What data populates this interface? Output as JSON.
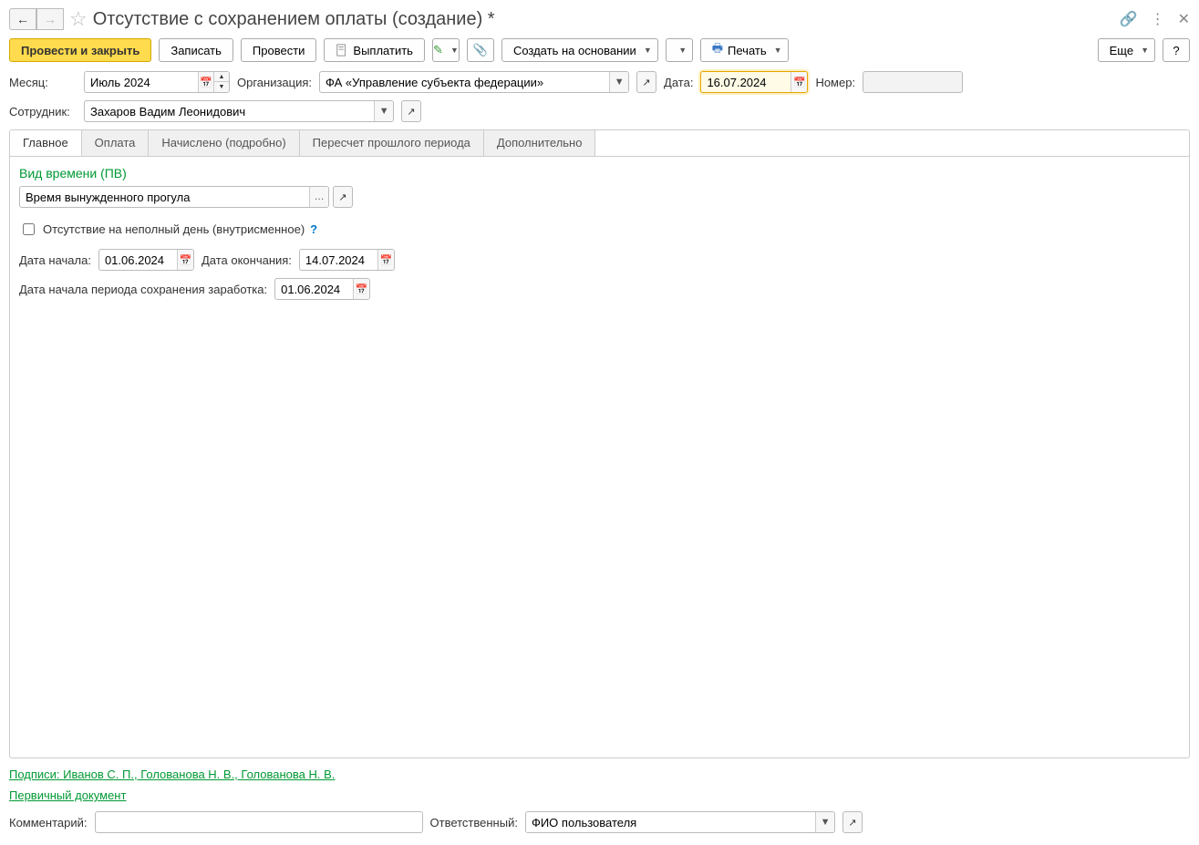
{
  "title": "Отсутствие с сохранением оплаты (создание) *",
  "toolbar": {
    "post_close": "Провести и закрыть",
    "save": "Записать",
    "post": "Провести",
    "pay": "Выплатить",
    "create_based": "Создать на основании",
    "print": "Печать",
    "more": "Еще",
    "help": "?"
  },
  "header": {
    "month_label": "Месяц:",
    "month_value": "Июль 2024",
    "org_label": "Организация:",
    "org_value": "ФА «Управление субъекта федерации»",
    "date_label": "Дата:",
    "date_value": "16.07.2024",
    "number_label": "Номер:",
    "number_value": "",
    "employee_label": "Сотрудник:",
    "employee_value": "Захаров Вадим Леонидович"
  },
  "tabs": {
    "main": "Главное",
    "payment": "Оплата",
    "accrued": "Начислено (подробно)",
    "recalc": "Пересчет прошлого периода",
    "extra": "Дополнительно"
  },
  "main_tab": {
    "time_type_title": "Вид времени (ПВ)",
    "time_type_value": "Время вынужденного прогула",
    "partial_day_label": "Отсутствие на неполный день (внутрисменное)",
    "start_date_label": "Дата начала:",
    "start_date_value": "01.06.2024",
    "end_date_label": "Дата окончания:",
    "end_date_value": "14.07.2024",
    "earn_start_label": "Дата начала периода сохранения заработка:",
    "earn_start_value": "01.06.2024"
  },
  "footer": {
    "signatures": "Подписи: Иванов С. П., Голованова Н. В., Голованова Н. В.",
    "primary_doc": "Первичный документ",
    "comment_label": "Комментарий:",
    "comment_value": "",
    "responsible_label": "Ответственный:",
    "responsible_value": "ФИО пользователя"
  },
  "icons": {
    "pay": "🖶",
    "print": "🖶",
    "highlight": "✎",
    "clip": "📎",
    "copy": "📑",
    "link": "🔗"
  }
}
